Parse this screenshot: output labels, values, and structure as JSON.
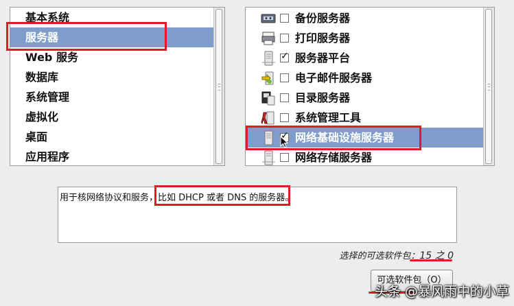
{
  "categories": [
    {
      "label": "基本系统",
      "selected": false
    },
    {
      "label": "服务器",
      "selected": true
    },
    {
      "label": "Web 服务",
      "selected": false
    },
    {
      "label": "数据库",
      "selected": false
    },
    {
      "label": "系统管理",
      "selected": false
    },
    {
      "label": "虚拟化",
      "selected": false
    },
    {
      "label": "桌面",
      "selected": false
    },
    {
      "label": "应用程序",
      "selected": false
    }
  ],
  "groups": [
    {
      "label": "备份服务器",
      "icon": "tape-drive-icon",
      "checked": false,
      "selected": false
    },
    {
      "label": "打印服务器",
      "icon": "printer-icon",
      "checked": false,
      "selected": false
    },
    {
      "label": "服务器平台",
      "icon": "server-icon",
      "checked": true,
      "selected": false
    },
    {
      "label": "电子邮件服务器",
      "icon": "mail-server-icon",
      "checked": false,
      "selected": false
    },
    {
      "label": "目录服务器",
      "icon": "directory-server-icon",
      "checked": false,
      "selected": false
    },
    {
      "label": "系统管理工具",
      "icon": "admin-tools-icon",
      "checked": false,
      "selected": false
    },
    {
      "label": "网络基础设施服务器",
      "icon": "server-icon",
      "checked": true,
      "selected": true
    },
    {
      "label": "网络存储服务器",
      "icon": "server-icon",
      "checked": false,
      "selected": false
    }
  ],
  "description": {
    "part1": "用于核网络协议和服务，",
    "part2": "比如 DHCP 或者 DNS 的服务器。"
  },
  "package_count": {
    "label": "选择的可选软件包：",
    "value": "15 之 0"
  },
  "optional_button": {
    "label": "可选软件包（O）"
  },
  "watermark": {
    "text": "头条 @暴风雨中的小草"
  },
  "colors": {
    "selection": "#7f9dca",
    "highlight_box": "#e01b24",
    "background": "#ededed"
  }
}
